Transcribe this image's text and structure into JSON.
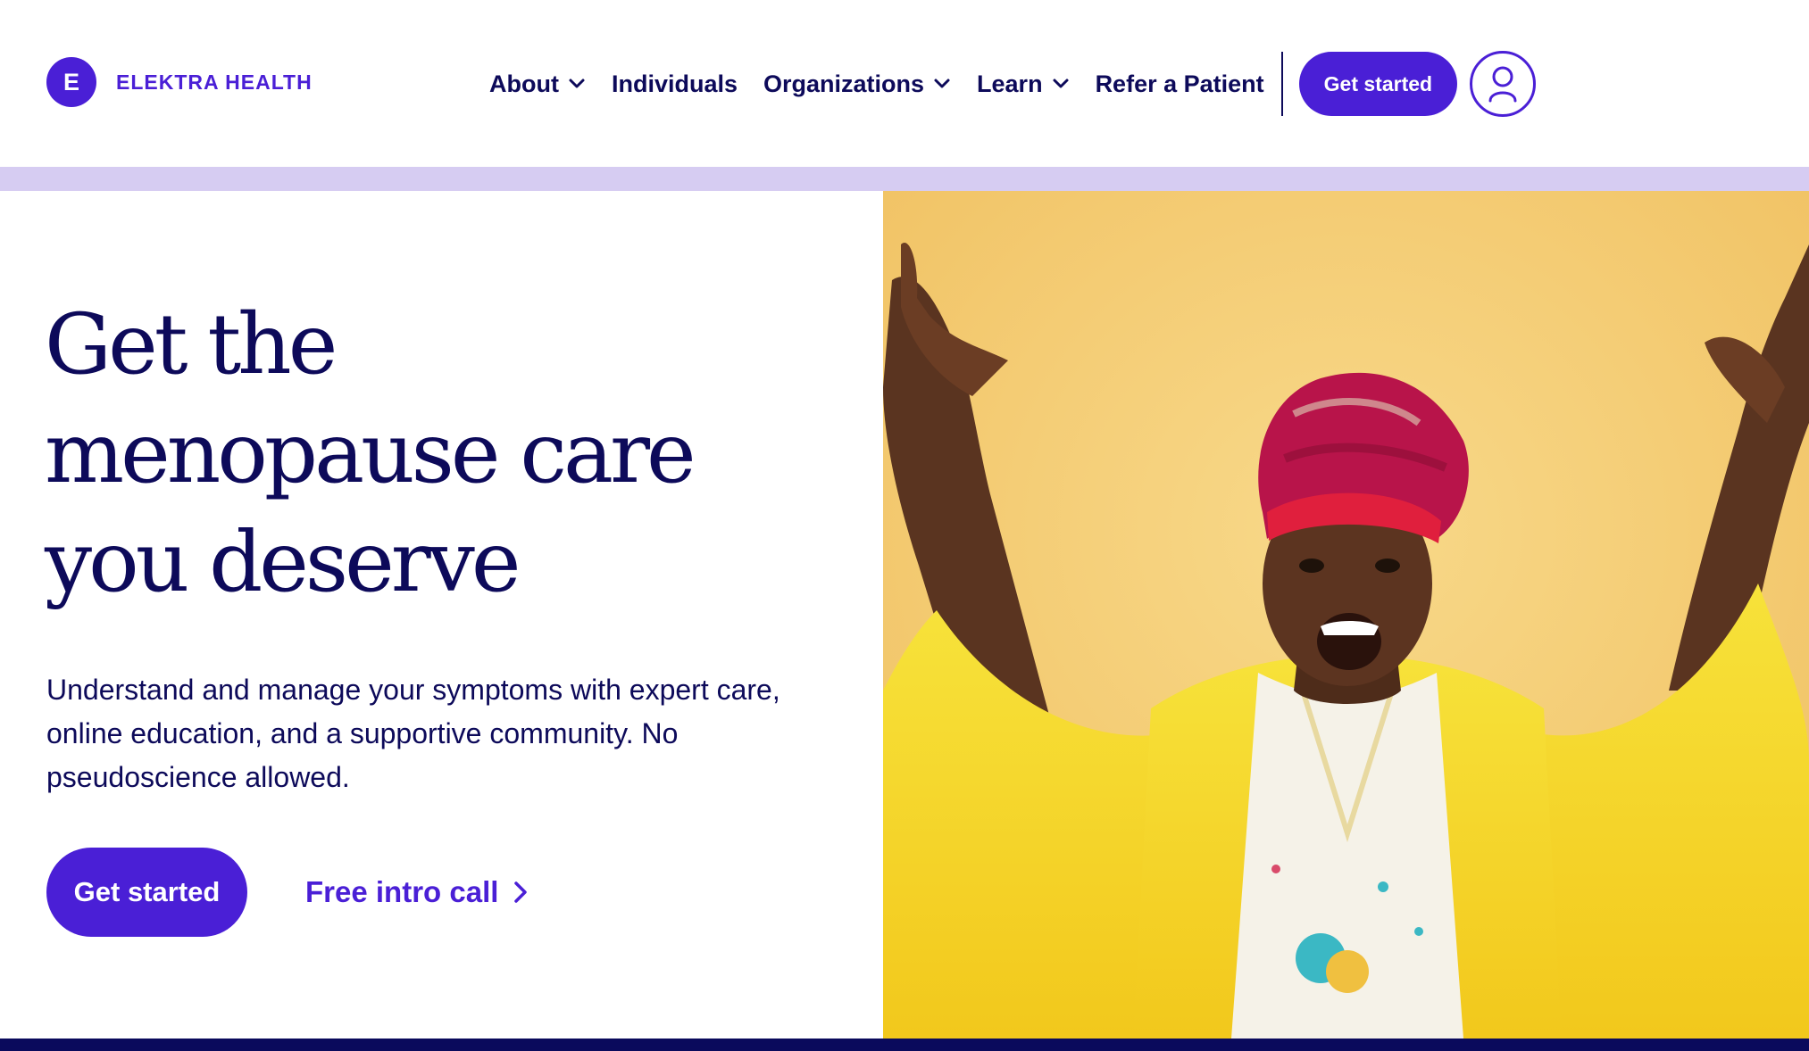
{
  "brand": {
    "initial": "E",
    "name": "ELEKTRA HEALTH",
    "color": "#4a1fd6"
  },
  "nav": {
    "items": [
      {
        "label": "About",
        "has_dropdown": true
      },
      {
        "label": "Individuals",
        "has_dropdown": false
      },
      {
        "label": "Organizations",
        "has_dropdown": true
      },
      {
        "label": "Learn",
        "has_dropdown": true
      },
      {
        "label": "Refer a Patient",
        "has_dropdown": false
      }
    ],
    "cta_label": "Get started",
    "account_icon": "user-icon"
  },
  "hero": {
    "headline_lines": [
      "Get the",
      "menopause care",
      "you deserve"
    ],
    "subhead_lines": [
      "Understand and manage your symptoms with expert care,",
      "online education, and a supportive community. No",
      "pseudoscience allowed."
    ],
    "primary_cta": "Get started",
    "secondary_cta": "Free intro call",
    "secondary_cta_icon": "chevron-right-icon"
  },
  "image": {
    "subject": "photo-of-celebrating-woman-in-yellow-dress-and-red-headwrap"
  },
  "colors": {
    "navy": "#0d0a5a",
    "purple": "#4a1fd6",
    "lavender_band": "#d6ccf2",
    "photo_background": "#f3c46a",
    "bottom_bar": "#0a0a5c"
  }
}
